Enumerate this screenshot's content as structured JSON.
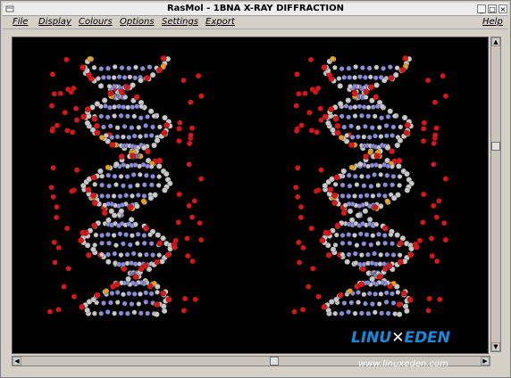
{
  "window": {
    "title": "RasMol - 1BNA X-RAY DIFFRACTION",
    "controls": {
      "minimize": "_",
      "maximize": "□",
      "close": "×"
    }
  },
  "menubar": {
    "items": [
      "File",
      "Display",
      "Colours",
      "Options",
      "Settings",
      "Export"
    ],
    "help": "Help"
  },
  "scrollbars": {
    "vertical_position": 0.33,
    "horizontal_position": 0.55
  },
  "watermark": {
    "brand_left": "LINU",
    "brand_right": "EDEN",
    "url": "www.linuxeden.com"
  },
  "colors": {
    "background": "#000000",
    "phosphorus": "#e8a020",
    "oxygen": "#d81818",
    "carbon": "#c8c8c8",
    "nitrogen": "#8c8cd8",
    "brand": "#1a8ad8"
  }
}
